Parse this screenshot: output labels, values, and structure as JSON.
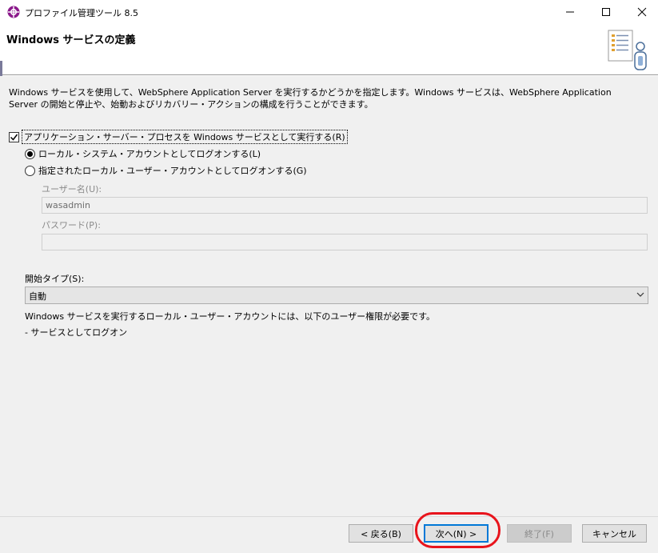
{
  "window": {
    "title": "プロファイル管理ツール 8.5",
    "controls": {
      "minimize": "–",
      "maximize": "☐",
      "close": "✕"
    }
  },
  "header": {
    "title": "Windows サービスの定義"
  },
  "description": "Windows サービスを使用して、WebSphere Application Server を実行するかどうかを指定します。Windows サービスは、WebSphere Application Server の開始と停止や、始動およびリカバリー・アクションの構成を行うことができます。",
  "run_as_service": {
    "checked": true,
    "label": "アプリケーション・サーバー・プロセスを Windows サービスとして実行する(R)"
  },
  "logon_options": [
    {
      "label": "ローカル・システム・アカウントとしてログオンする(L)",
      "selected": true
    },
    {
      "label": "指定されたローカル・ユーザー・アカウントとしてログオンする(G)",
      "selected": false
    }
  ],
  "username": {
    "label": "ユーザー名(U):",
    "value": "wasadmin"
  },
  "password": {
    "label": "パスワード(P):",
    "value": ""
  },
  "startup_type": {
    "label": "開始タイプ(S):",
    "value": "自動"
  },
  "notes": {
    "requirement": "Windows サービスを実行するローカル・ユーザー・アカウントには、以下のユーザー権限が必要です。",
    "right": "- サービスとしてログオン"
  },
  "buttons": {
    "back": "< 戻る(B)",
    "next": "次へ(N) >",
    "finish": "終了(F)",
    "cancel": "キャンセル"
  },
  "colors": {
    "highlight": "#e8141c",
    "default_button_border": "#0078d7",
    "app_icon": "#8b1a8b"
  }
}
